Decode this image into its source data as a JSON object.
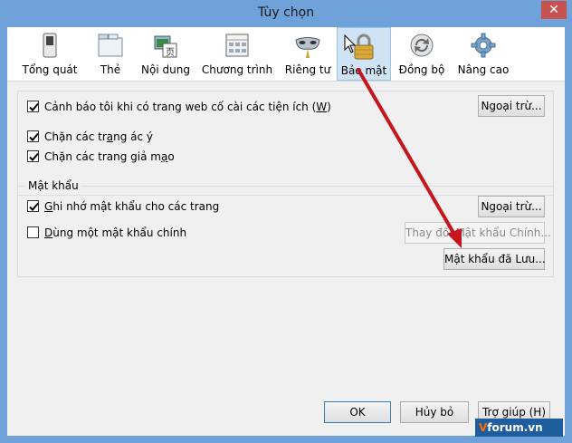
{
  "window": {
    "title": "Tùy chọn",
    "close_label": "✕"
  },
  "tabs": [
    {
      "label": "Tổng quát",
      "icon": "switch-icon"
    },
    {
      "label": "Thẻ",
      "icon": "tabs-icon"
    },
    {
      "label": "Nội dung",
      "icon": "content-icon"
    },
    {
      "label": "Chương trình",
      "icon": "applications-icon"
    },
    {
      "label": "Riêng tư",
      "icon": "mask-icon"
    },
    {
      "label": "Bảo mật",
      "icon": "padlock-icon",
      "selected": true
    },
    {
      "label": "Đồng bộ",
      "icon": "sync-icon"
    },
    {
      "label": "Nâng cao",
      "icon": "gear-icon"
    }
  ],
  "security": {
    "warn_addons": {
      "label_pre": "Cảnh báo tôi khi có trang web cố cài các tiện ích (",
      "hotkey": "W",
      "label_post": ")",
      "checked": true
    },
    "exceptions_1": "Ngoại trừ...",
    "block_attack": {
      "label_pre": "Chặn các tr",
      "hotkey": "a",
      "label_post": "ng ác ý",
      "checked": true
    },
    "block_forgery": {
      "label_pre": "Chặn các trang giả m",
      "hotkey": "ạ",
      "label_post": "o",
      "checked": true
    }
  },
  "passwords": {
    "section_title": "Mật khẩu",
    "remember": {
      "label_pre": "",
      "hotkey": "G",
      "label_post": "hi nhớ mật khẩu cho các trang",
      "checked": true
    },
    "exceptions_2": "Ngoại trừ...",
    "master": {
      "label_pre": "",
      "hotkey": "D",
      "label_post": "ùng một mật khẩu chính",
      "checked": false
    },
    "change_master": "Thay đổi Mật khẩu Chính...",
    "saved_passwords": "Mật khẩu đã Lưu..."
  },
  "footer": {
    "ok": "OK",
    "cancel": "Hủy bỏ",
    "help": "Trợ giúp (H)"
  },
  "watermark": {
    "prefix": "V",
    "text": "forum.vn"
  },
  "colors": {
    "accent": "#6fa2d8",
    "arrow": "#c4161c",
    "selected_tab": "#cfe3f5"
  }
}
